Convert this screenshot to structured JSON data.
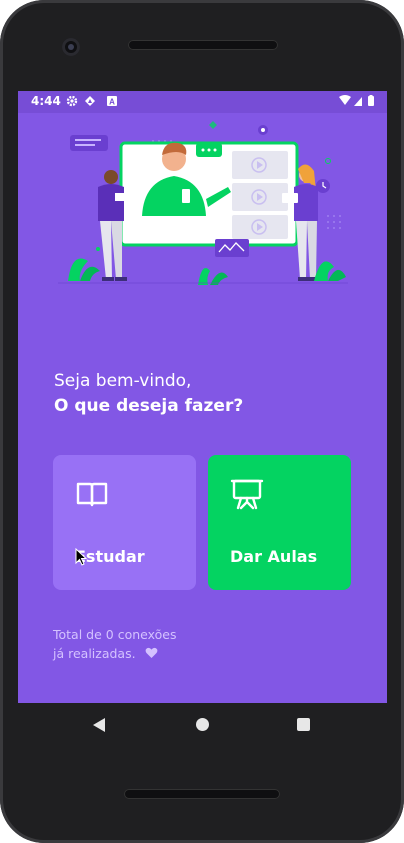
{
  "status_bar": {
    "time": "4:44",
    "icons": [
      "settings-icon",
      "android-icon",
      "a-badge-icon"
    ],
    "right_icons": [
      "wifi-icon",
      "signal-icon",
      "battery-icon"
    ]
  },
  "welcome": {
    "line1": "Seja bem-vindo,",
    "line2": "O que deseja fazer?"
  },
  "actions": {
    "study": {
      "label": "Estudar",
      "icon": "book-open-icon",
      "color": "#9871f5"
    },
    "teach": {
      "label": "Dar Aulas",
      "icon": "presentation-icon",
      "color": "#04d361"
    }
  },
  "connections": {
    "line1": "Total de 0 conexões",
    "line2": "já realizadas.",
    "icon": "heart-icon"
  },
  "colors": {
    "primary": "#8257e5",
    "status_bar": "#774dd6",
    "secondary": "#04d361",
    "text_muted": "#d4c2ff"
  },
  "nav": {
    "buttons": [
      "back-icon",
      "home-icon",
      "recents-icon"
    ]
  }
}
